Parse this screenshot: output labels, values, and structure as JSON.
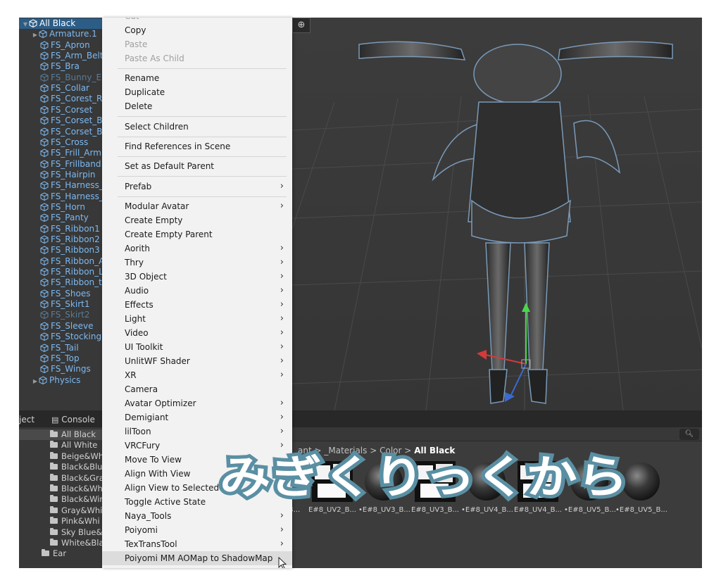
{
  "hierarchy": {
    "items": [
      {
        "label": "All Black",
        "kind": "root"
      },
      {
        "label": "Armature.1",
        "kind": "parent"
      },
      {
        "label": "FS_Apron",
        "kind": "child"
      },
      {
        "label": "FS_Arm_Belt",
        "kind": "child"
      },
      {
        "label": "FS_Bra",
        "kind": "child"
      },
      {
        "label": "FS_Bunny_E",
        "kind": "dim"
      },
      {
        "label": "FS_Collar",
        "kind": "child"
      },
      {
        "label": "FS_Corest_R",
        "kind": "child"
      },
      {
        "label": "FS_Corset",
        "kind": "child"
      },
      {
        "label": "FS_Corset_B",
        "kind": "child"
      },
      {
        "label": "FS_Corset_B",
        "kind": "child"
      },
      {
        "label": "FS_Cross",
        "kind": "child"
      },
      {
        "label": "FS_Frill_Arm",
        "kind": "child"
      },
      {
        "label": "FS_Frillband",
        "kind": "child"
      },
      {
        "label": "FS_Hairpin",
        "kind": "child"
      },
      {
        "label": "FS_Harness_",
        "kind": "child"
      },
      {
        "label": "FS_Harness_",
        "kind": "child"
      },
      {
        "label": "FS_Horn",
        "kind": "child"
      },
      {
        "label": "FS_Panty",
        "kind": "child"
      },
      {
        "label": "FS_Ribbon1",
        "kind": "child"
      },
      {
        "label": "FS_Ribbon2",
        "kind": "child"
      },
      {
        "label": "FS_Ribbon3",
        "kind": "child"
      },
      {
        "label": "FS_Ribbon_A",
        "kind": "child"
      },
      {
        "label": "FS_Ribbon_L",
        "kind": "child"
      },
      {
        "label": "FS_Ribbon_t",
        "kind": "child"
      },
      {
        "label": "FS_Shoes",
        "kind": "child"
      },
      {
        "label": "FS_Skirt1",
        "kind": "child"
      },
      {
        "label": "FS_Skirt2",
        "kind": "dim"
      },
      {
        "label": "FS_Sleeve",
        "kind": "child"
      },
      {
        "label": "FS_Stocking",
        "kind": "child"
      },
      {
        "label": "FS_Tail",
        "kind": "child"
      },
      {
        "label": "FS_Top",
        "kind": "child"
      },
      {
        "label": "FS_Wings",
        "kind": "child"
      },
      {
        "label": "Physics",
        "kind": "parent"
      }
    ]
  },
  "tabs": {
    "project": "ject",
    "console": "Console"
  },
  "project_tree": [
    {
      "label": "All Black",
      "selected": true
    },
    {
      "label": "All White",
      "selected": false
    },
    {
      "label": "Beige&Wh",
      "selected": false
    },
    {
      "label": "Black&Blu",
      "selected": false
    },
    {
      "label": "Black&Gra",
      "selected": false
    },
    {
      "label": "Black&Wh",
      "selected": false
    },
    {
      "label": "Black&Wir",
      "selected": false
    },
    {
      "label": "Gray&Whi",
      "selected": false
    },
    {
      "label": "Pink&Whi",
      "selected": false
    },
    {
      "label": "Sky Blue&",
      "selected": false
    },
    {
      "label": "White&Bla",
      "selected": false
    },
    {
      "label": "Ear",
      "selected": false
    }
  ],
  "breadcrumb": {
    "part1": "ant",
    "part2": "_Materials",
    "part3": "Color",
    "current": "All Black",
    "separator": ">"
  },
  "assets": [
    {
      "label": "B...",
      "style": "partial"
    },
    {
      "label": "E#8_UV2_B...",
      "style": "white"
    },
    {
      "label": "•E#8_UV3_B...",
      "style": "sphere"
    },
    {
      "label": "E#8_UV3_B...",
      "style": "white"
    },
    {
      "label": "•E#8_UV4_B...",
      "style": "sphere"
    },
    {
      "label": "E#8_UV4_B...",
      "style": "white"
    },
    {
      "label": "•E#8_UV5_B...",
      "style": "sphere"
    },
    {
      "label": "•E#8_UV5_B...",
      "style": "sphere"
    }
  ],
  "context_menu": {
    "items": [
      {
        "label": "Cut",
        "type": "disabled"
      },
      {
        "label": "Copy",
        "type": "item"
      },
      {
        "label": "Paste",
        "type": "disabled"
      },
      {
        "label": "Paste As Child",
        "type": "disabled"
      },
      {
        "type": "sep"
      },
      {
        "label": "Rename",
        "type": "item"
      },
      {
        "label": "Duplicate",
        "type": "item"
      },
      {
        "label": "Delete",
        "type": "item"
      },
      {
        "type": "sep"
      },
      {
        "label": "Select Children",
        "type": "item"
      },
      {
        "type": "sep"
      },
      {
        "label": "Find References in Scene",
        "type": "item"
      },
      {
        "type": "sep"
      },
      {
        "label": "Set as Default Parent",
        "type": "item"
      },
      {
        "type": "sep"
      },
      {
        "label": "Prefab",
        "type": "submenu"
      },
      {
        "type": "sep"
      },
      {
        "label": "Modular Avatar",
        "type": "submenu"
      },
      {
        "label": "Create Empty",
        "type": "item"
      },
      {
        "label": "Create Empty Parent",
        "type": "item"
      },
      {
        "label": "Aorith",
        "type": "submenu"
      },
      {
        "label": "Thry",
        "type": "submenu"
      },
      {
        "label": "3D Object",
        "type": "submenu"
      },
      {
        "label": "Audio",
        "type": "submenu"
      },
      {
        "label": "Effects",
        "type": "submenu"
      },
      {
        "label": "Light",
        "type": "submenu"
      },
      {
        "label": "Video",
        "type": "submenu"
      },
      {
        "label": "UI Toolkit",
        "type": "submenu"
      },
      {
        "label": "UnlitWF Shader",
        "type": "submenu"
      },
      {
        "label": "XR",
        "type": "submenu"
      },
      {
        "label": "Camera",
        "type": "item"
      },
      {
        "label": "Avatar Optimizer",
        "type": "submenu"
      },
      {
        "label": "Demigiant",
        "type": "submenu"
      },
      {
        "label": "lilToon",
        "type": "submenu"
      },
      {
        "label": "VRCFury",
        "type": "submenu"
      },
      {
        "label": "Move To View",
        "type": "item"
      },
      {
        "label": "Align With View",
        "type": "item"
      },
      {
        "label": "Align View to Selected",
        "type": "item"
      },
      {
        "label": "Toggle Active State",
        "type": "item"
      },
      {
        "label": "Naya_Tools",
        "type": "submenu"
      },
      {
        "label": "Poiyomi",
        "type": "submenu"
      },
      {
        "label": "TexTransTool",
        "type": "submenu"
      },
      {
        "label": "Poiyomi MM AOMap to ShadowMap",
        "type": "hover"
      }
    ],
    "submenu_glyph": "›"
  },
  "overlay_caption": "みぎくりっくから",
  "colors": {
    "hierarchy_text": "#7cb9f2",
    "selection": "#2c5d87",
    "menu_bg": "#f2f2f2",
    "caption_fill": "#ffffff",
    "caption_stroke": "#5a8fa3"
  }
}
